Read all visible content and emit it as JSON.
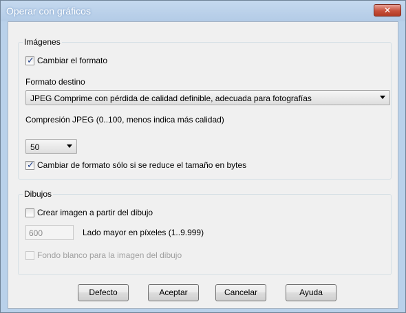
{
  "window": {
    "title": "Operar con gráficos",
    "close_glyph": "✕"
  },
  "imagenes": {
    "title": "Imágenes",
    "cambiar_formato": {
      "label": "Cambiar el formato",
      "checked": true
    },
    "formato_destino_label": "Formato destino",
    "formato_destino_value": "JPEG Comprime con pérdida de calidad definible, adecuada para fotografías",
    "compresion_label": "Compresión JPEG (0..100, menos indica más calidad)",
    "compresion_value": "50",
    "solo_si_reduce": {
      "label": "Cambiar de formato sólo si se reduce el tamaño en bytes",
      "checked": true
    }
  },
  "dibujos": {
    "title": "Dibujos",
    "crear_imagen": {
      "label": "Crear imagen a partir del dibujo",
      "checked": false
    },
    "lado_mayor_value": "600",
    "lado_mayor_label": "Lado mayor en píxeles (1..9.999)",
    "fondo_blanco": {
      "label": "Fondo blanco para la imagen del dibujo",
      "checked": false,
      "enabled": false
    }
  },
  "buttons": {
    "defecto": "Defecto",
    "aceptar": "Aceptar",
    "cancelar": "Cancelar",
    "ayuda": "Ayuda"
  }
}
